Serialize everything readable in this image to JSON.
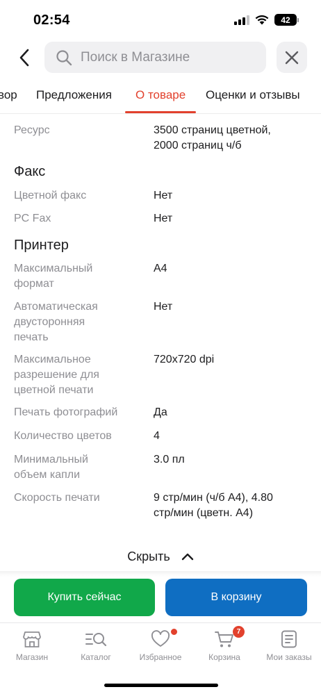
{
  "status_bar": {
    "time": "02:54",
    "battery": "42"
  },
  "search": {
    "placeholder": "Поиск в Магазине"
  },
  "tabs": [
    {
      "label": "вор"
    },
    {
      "label": "Предложения"
    },
    {
      "label": "О товаре"
    },
    {
      "label": "Оценки и отзывы"
    }
  ],
  "specs": {
    "resource": {
      "label": "Ресурс",
      "value": "3500 страниц цветной,\n2000 страниц ч/б"
    },
    "fax_title": "Факс",
    "fax": [
      {
        "label": "Цветной факс",
        "value": "Нет"
      },
      {
        "label": "PC Fax",
        "value": "Нет"
      }
    ],
    "printer_title": "Принтер",
    "printer": [
      {
        "label": "Максимальный\nформат",
        "value": "A4"
      },
      {
        "label": "Автоматическая\nдвусторонняя\nпечать",
        "value": "Нет"
      },
      {
        "label": "Максимальное\nразрешение для\nцветной печати",
        "value": "720x720 dpi"
      },
      {
        "label": "Печать фотографий",
        "value": "Да"
      },
      {
        "label": "Количество цветов",
        "value": "4"
      },
      {
        "label": "Минимальный\nобъем капли",
        "value": "3.0 пл"
      },
      {
        "label": "Скорость печати",
        "value": "9 стр/мин (ч/б А4), 4.80\nстр/мин (цветн. А4)"
      }
    ]
  },
  "hide_label": "Скрыть",
  "actions": {
    "buy_now": "Купить сейчас",
    "add_to_cart": "В корзину"
  },
  "bottom_nav": [
    {
      "label": "Магазин",
      "icon": "store-icon"
    },
    {
      "label": "Каталог",
      "icon": "catalog-search-icon"
    },
    {
      "label": "Избранное",
      "icon": "heart-icon"
    },
    {
      "label": "Корзина",
      "icon": "cart-icon",
      "badge": "7"
    },
    {
      "label": "Мои заказы",
      "icon": "orders-icon"
    }
  ],
  "colors": {
    "accent": "#e2412d",
    "buy": "#11a84a",
    "cart": "#0f6ec2",
    "muted": "#8e8e93"
  }
}
